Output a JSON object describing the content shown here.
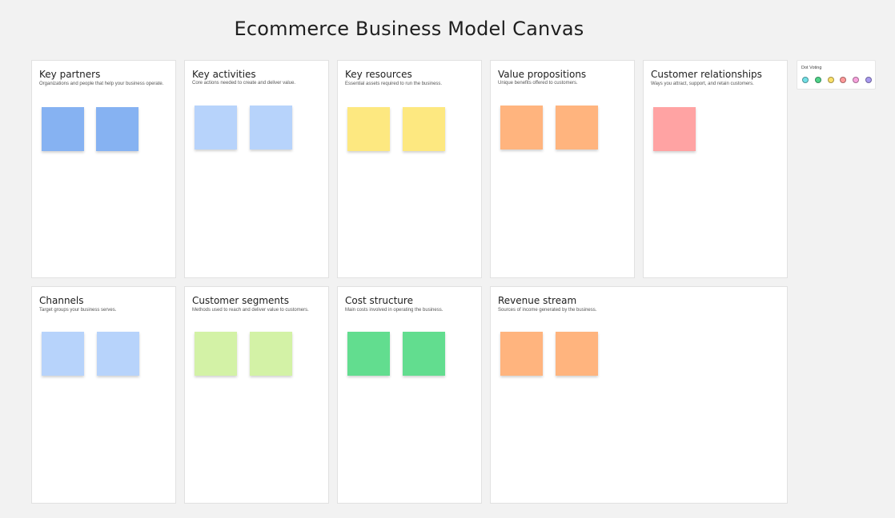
{
  "board": {
    "title": "Ecommerce Business Model Canvas"
  },
  "cards": [
    {
      "title": "Key partners",
      "desc": "Organizations and people that help your business operate.",
      "sticky_color": "#86b2f2"
    },
    {
      "title": "Key activities",
      "desc": "Core actions needed to create and deliver value.",
      "sticky_color": "#b7d3fb"
    },
    {
      "title": "Key resources",
      "desc": "Essential assets required to run the business.",
      "sticky_color": "#fde880"
    },
    {
      "title": "Value propositions",
      "desc": "Unique benefits offered to customers.",
      "sticky_color": "#ffb47e"
    },
    {
      "title": "Customer relationships",
      "desc": "Ways you attract, support, and retain customers.",
      "sticky_color": "#ffa3a3"
    },
    {
      "title": "Channels",
      "desc": "Target groups your business serves.",
      "sticky_color": "#b7d3fb"
    },
    {
      "title": "Customer segments",
      "desc": "Methods used to reach and deliver value to customers.",
      "sticky_color": "#d3f2a6"
    },
    {
      "title": "Cost structure",
      "desc": "Main costs involved in operating the business.",
      "sticky_color": "#62dd8f"
    },
    {
      "title": "Revenue stream",
      "desc": "Sources of income generated by the business.",
      "sticky_color": "#ffb47e"
    }
  ],
  "dot_voting": {
    "title": "Dot Voting",
    "colors": [
      "#73e0e6",
      "#4fd389",
      "#fbe06a",
      "#ff9a9a",
      "#f8a3dd",
      "#a99af0"
    ]
  }
}
